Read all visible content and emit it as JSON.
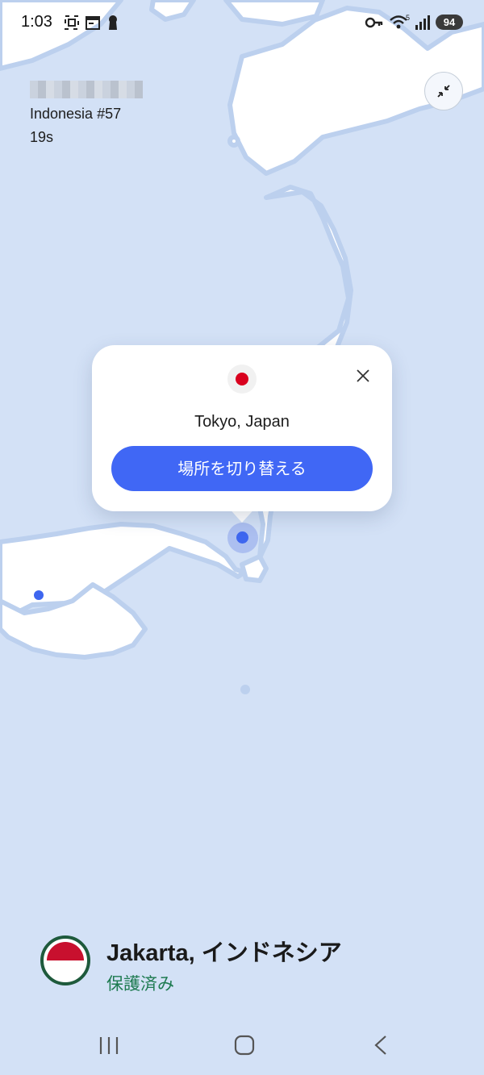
{
  "status_bar": {
    "time": "1:03",
    "battery": "94",
    "icons": [
      "screenshot-icon",
      "calendar-icon",
      "keyhole-icon",
      "vpn-key-icon",
      "wifi-icon",
      "signal-icon"
    ],
    "wifi_badge": "5"
  },
  "connection": {
    "server": "Indonesia #57",
    "duration": "19s"
  },
  "popup": {
    "city": "Tokyo, Japan",
    "switch_label": "場所を切り替える",
    "flag": "japan-flag"
  },
  "current_location": {
    "title": "Jakarta, インドネシア",
    "status": "保護済み",
    "flag": "indonesia-flag"
  },
  "colors": {
    "sea": "#d3e1f6",
    "land": "#ffffff",
    "accent": "#4067f5",
    "protected": "#1d7a50"
  }
}
